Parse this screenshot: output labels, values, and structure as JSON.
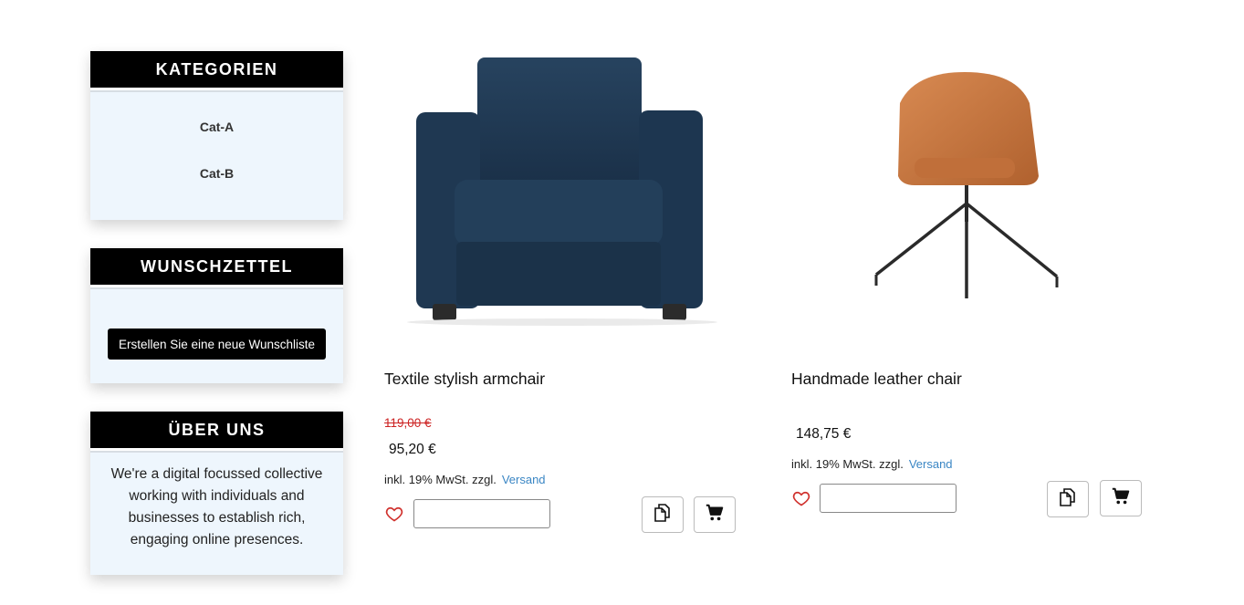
{
  "sidebar": {
    "categories": {
      "title": "KATEGORIEN",
      "items": [
        {
          "label": "Cat-A"
        },
        {
          "label": "Cat-B"
        }
      ]
    },
    "wishlist": {
      "title": "WUNSCHZETTEL",
      "button_label": "Erstellen Sie eine neue Wunschliste"
    },
    "about": {
      "title": "ÜBER UNS",
      "text": "We're a digital focussed collective working with individuals and businesses to establish rich, engaging online presences."
    }
  },
  "products": [
    {
      "title": "Textile stylish armchair",
      "old_price": "119,00 €",
      "price": "95,20 €",
      "tax_text": "inkl. 19% MwSt. zzgl.",
      "shipping_link": "Versand",
      "quantity_value": "",
      "image_icon": "armchair-image",
      "color": "#1f3852"
    },
    {
      "title": "Handmade leather chair",
      "old_price": "",
      "price": "148,75 €",
      "tax_text": "inkl. 19% MwSt. zzgl.",
      "shipping_link": "Versand",
      "quantity_value": "",
      "image_icon": "leather-chair-image",
      "color": "#c4733f"
    }
  ],
  "colors": {
    "accent_black": "#000000",
    "widget_bg": "#eef6fd",
    "link_blue": "#3a86c4",
    "heart_red": "#d0312d",
    "old_price_red": "#c22222"
  }
}
